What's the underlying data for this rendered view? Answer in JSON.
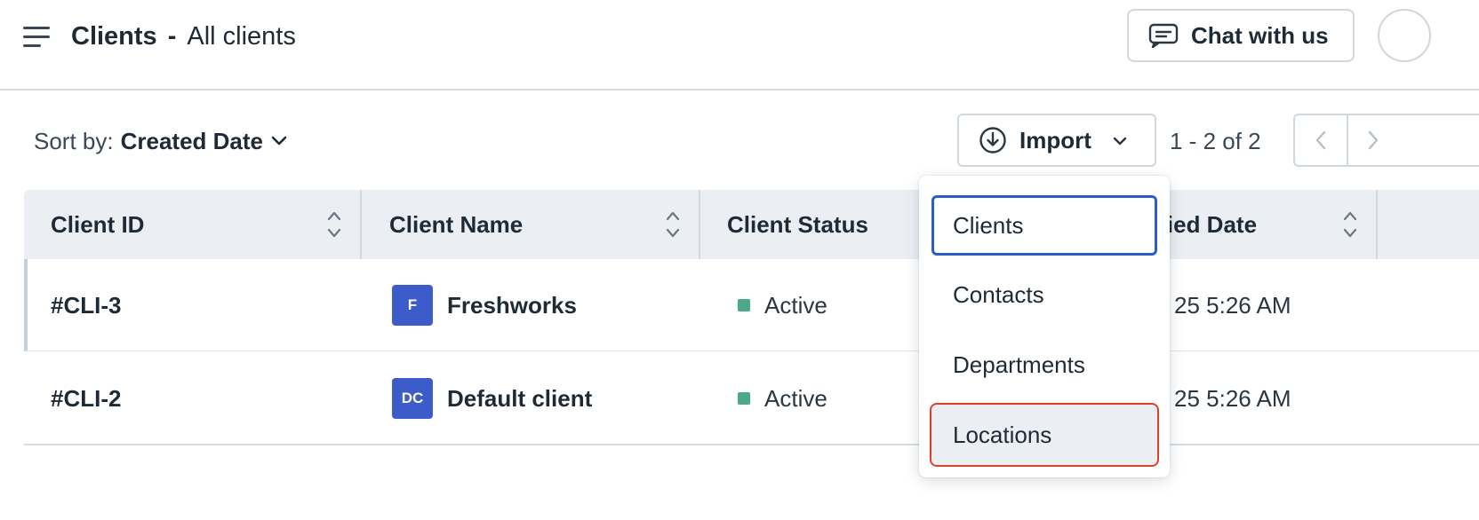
{
  "header": {
    "menu_icon": "hamburger-menu-icon",
    "breadcrumb_main": "Clients",
    "breadcrumb_separator": "-",
    "breadcrumb_sub": "All clients",
    "chat_button_label": "Chat with us",
    "chat_icon": "chat-bubble-icon"
  },
  "toolbar": {
    "sort_label": "Sort by:",
    "sort_value": "Created Date",
    "import_label": "Import",
    "import_icon": "download-circle-icon",
    "pagination_text": "1 - 2 of 2"
  },
  "table": {
    "columns": [
      {
        "label": "Client ID"
      },
      {
        "label": "Client Name"
      },
      {
        "label": "Client Status"
      },
      {
        "label": "ified Date"
      }
    ],
    "rows": [
      {
        "id": "#CLI-3",
        "badge": "F",
        "name": "Freshworks",
        "status": "Active",
        "modified": "25 5:26 AM"
      },
      {
        "id": "#CLI-2",
        "badge": "DC",
        "name": "Default client",
        "status": "Active",
        "modified": "25 5:26 AM"
      }
    ]
  },
  "import_menu": {
    "items": [
      {
        "label": "Clients",
        "state": "focused"
      },
      {
        "label": "Contacts",
        "state": "default"
      },
      {
        "label": "Departments",
        "state": "default"
      },
      {
        "label": "Locations",
        "state": "hovered"
      }
    ]
  },
  "colors": {
    "badge": "#3b5cc9",
    "status_active": "#4aa98a",
    "focus_border": "#2c5cc5",
    "highlight_outline": "#e0402a"
  }
}
